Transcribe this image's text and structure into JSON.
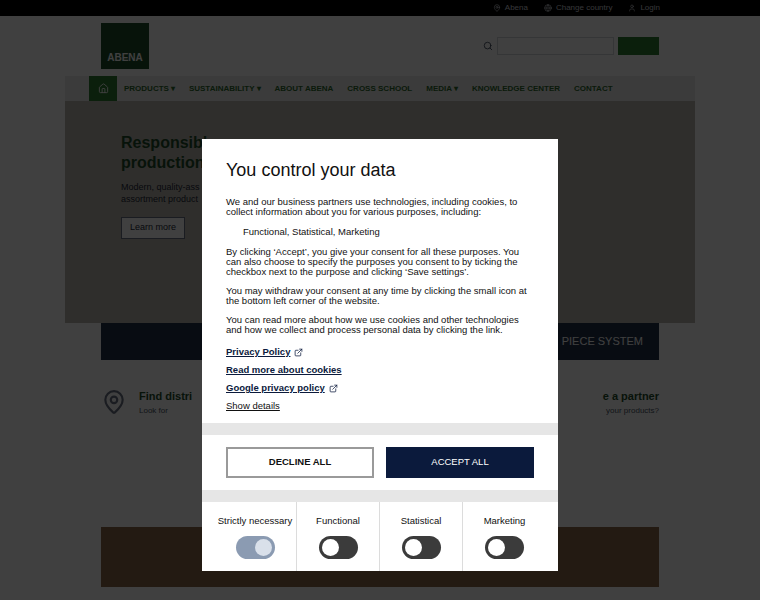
{
  "site": {
    "topbar": [
      "Abena",
      "Change country",
      "Login"
    ],
    "logo": "ABENA",
    "nav": [
      {
        "label": "PRODUCTS",
        "dropdown": true,
        "arrow": "▾"
      },
      {
        "label": "SUSTAINABILITY",
        "dropdown": true,
        "arrow": "▾"
      },
      {
        "label": "ABOUT ABENA",
        "dropdown": false,
        "arrow": ""
      },
      {
        "label": "CROSS SCHOOL",
        "dropdown": false,
        "arrow": ""
      },
      {
        "label": "MEDIA",
        "dropdown": true,
        "arrow": "▾"
      },
      {
        "label": "KNOWLEDGE CENTER",
        "dropdown": false,
        "arrow": ""
      },
      {
        "label": "CONTACT",
        "dropdown": false,
        "arrow": ""
      }
    ],
    "hero": {
      "title": [
        "Responsibly",
        "production"
      ],
      "text": [
        "Modern, quality-ass",
        "assortment product"
      ],
      "button": "Learn more"
    },
    "strip": {
      "right": "PIECE SYSTEM"
    },
    "find": {
      "left": "Find distri",
      "left_sub": "Look for",
      "right": "e a partner",
      "right_sub": "your products?"
    }
  },
  "dialog": {
    "title": "You control your data",
    "intro": "We and our business partners use technologies, including cookies, to collect information about you for various purposes, including:",
    "purposes": "Functional, Statistical, Marketing",
    "paragraphs": [
      "By clicking ‘Accept’, you give your consent for all these purposes. You can also choose to specify the purposes you consent to by ticking the checkbox next to the purpose and clicking ‘Save settings’.",
      "You may withdraw your consent at any time by clicking the small icon at the bottom left corner of the website.",
      "You can read more about how we use cookies and other technologies and how we collect and process personal data by clicking the link."
    ],
    "links": [
      {
        "label": "Privacy Policy",
        "external": true,
        "bold": true
      },
      {
        "label": "Read more about cookies",
        "external": false,
        "bold": true
      },
      {
        "label": "Google privacy policy",
        "external": true,
        "bold": true
      },
      {
        "label": "Show details",
        "external": false,
        "bold": false
      }
    ],
    "buttons": [
      {
        "label": "DECLINE ALL",
        "kind": "secondary"
      },
      {
        "label": "ACCEPT ALL",
        "kind": "primary"
      }
    ],
    "categories": [
      {
        "label": "Strictly necessary",
        "on": true,
        "disabled": true
      },
      {
        "label": "Functional",
        "on": false,
        "disabled": false
      },
      {
        "label": "Statistical",
        "on": false,
        "disabled": false
      },
      {
        "label": "Marketing",
        "on": false,
        "disabled": false
      }
    ]
  }
}
